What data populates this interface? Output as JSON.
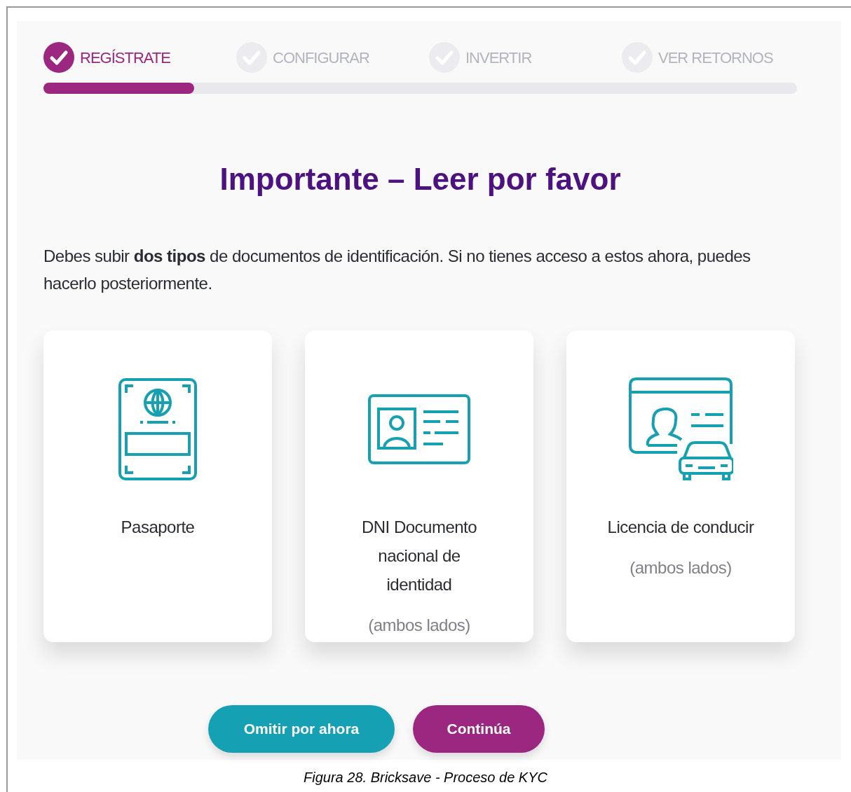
{
  "steps": [
    {
      "label": "REGÍSTRATE",
      "selected": true
    },
    {
      "label": "CONFIGURAR",
      "selected": false
    },
    {
      "label": "INVERTIR",
      "selected": false
    },
    {
      "label": "VER RETORNOS",
      "selected": false
    }
  ],
  "progress": {
    "level": 0.2
  },
  "heading": "Importante – Leer por favor",
  "intro": "Debes subir **dos tipos** de documentos de identificación. Si no tienes acceso a estos ahora, puedes hacerlo posteriormente.",
  "cards": [
    {
      "kind": "passport",
      "title": "Pasaporte"
    },
    {
      "kind": "id",
      "title": "DNI Documento nacional de identidad",
      "note": "(ambos lados)"
    },
    {
      "kind": "license",
      "title": "Licencia de conducir",
      "note": "(ambos lados)"
    }
  ],
  "buttons": [
    {
      "kind": "secondary",
      "label": "Omitir por ahora"
    },
    {
      "kind": "primary",
      "label": "Continúa"
    }
  ],
  "caption": "Figura 28. Bricksave - Proceso de KYC"
}
